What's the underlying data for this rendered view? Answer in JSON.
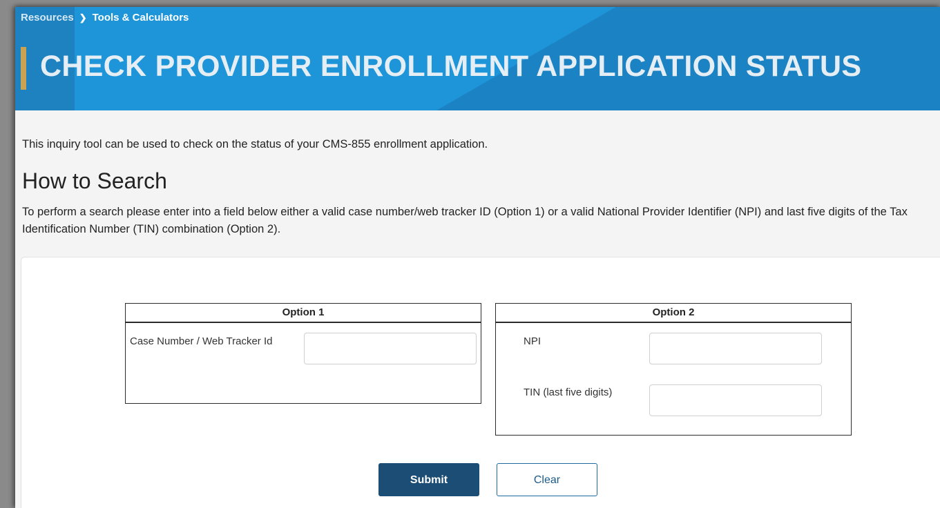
{
  "breadcrumb": {
    "root": "Resources",
    "current": "Tools & Calculators"
  },
  "header": {
    "title": "CHECK PROVIDER ENROLLMENT APPLICATION STATUS"
  },
  "intro": "This inquiry tool can be used to check on the status of your CMS-855 enrollment application.",
  "how_to": {
    "heading": "How to Search",
    "text": "To perform a search please enter into a field below either a valid case number/web tracker ID (Option 1) or a valid National Provider Identifier (NPI) and last five digits of the Tax Identification Number (TIN) combination (Option 2)."
  },
  "option1": {
    "title": "Option 1",
    "case_label": "Case Number / Web Tracker Id",
    "case_value": ""
  },
  "option2": {
    "title": "Option 2",
    "npi_label": "NPI",
    "npi_value": "",
    "tin_label": "TIN (last five digits)",
    "tin_value": ""
  },
  "buttons": {
    "submit": "Submit",
    "clear": "Clear"
  },
  "colors": {
    "banner": "#1b82c4",
    "title_accent": "#c9a352",
    "submit_bg": "#1b4d75"
  }
}
